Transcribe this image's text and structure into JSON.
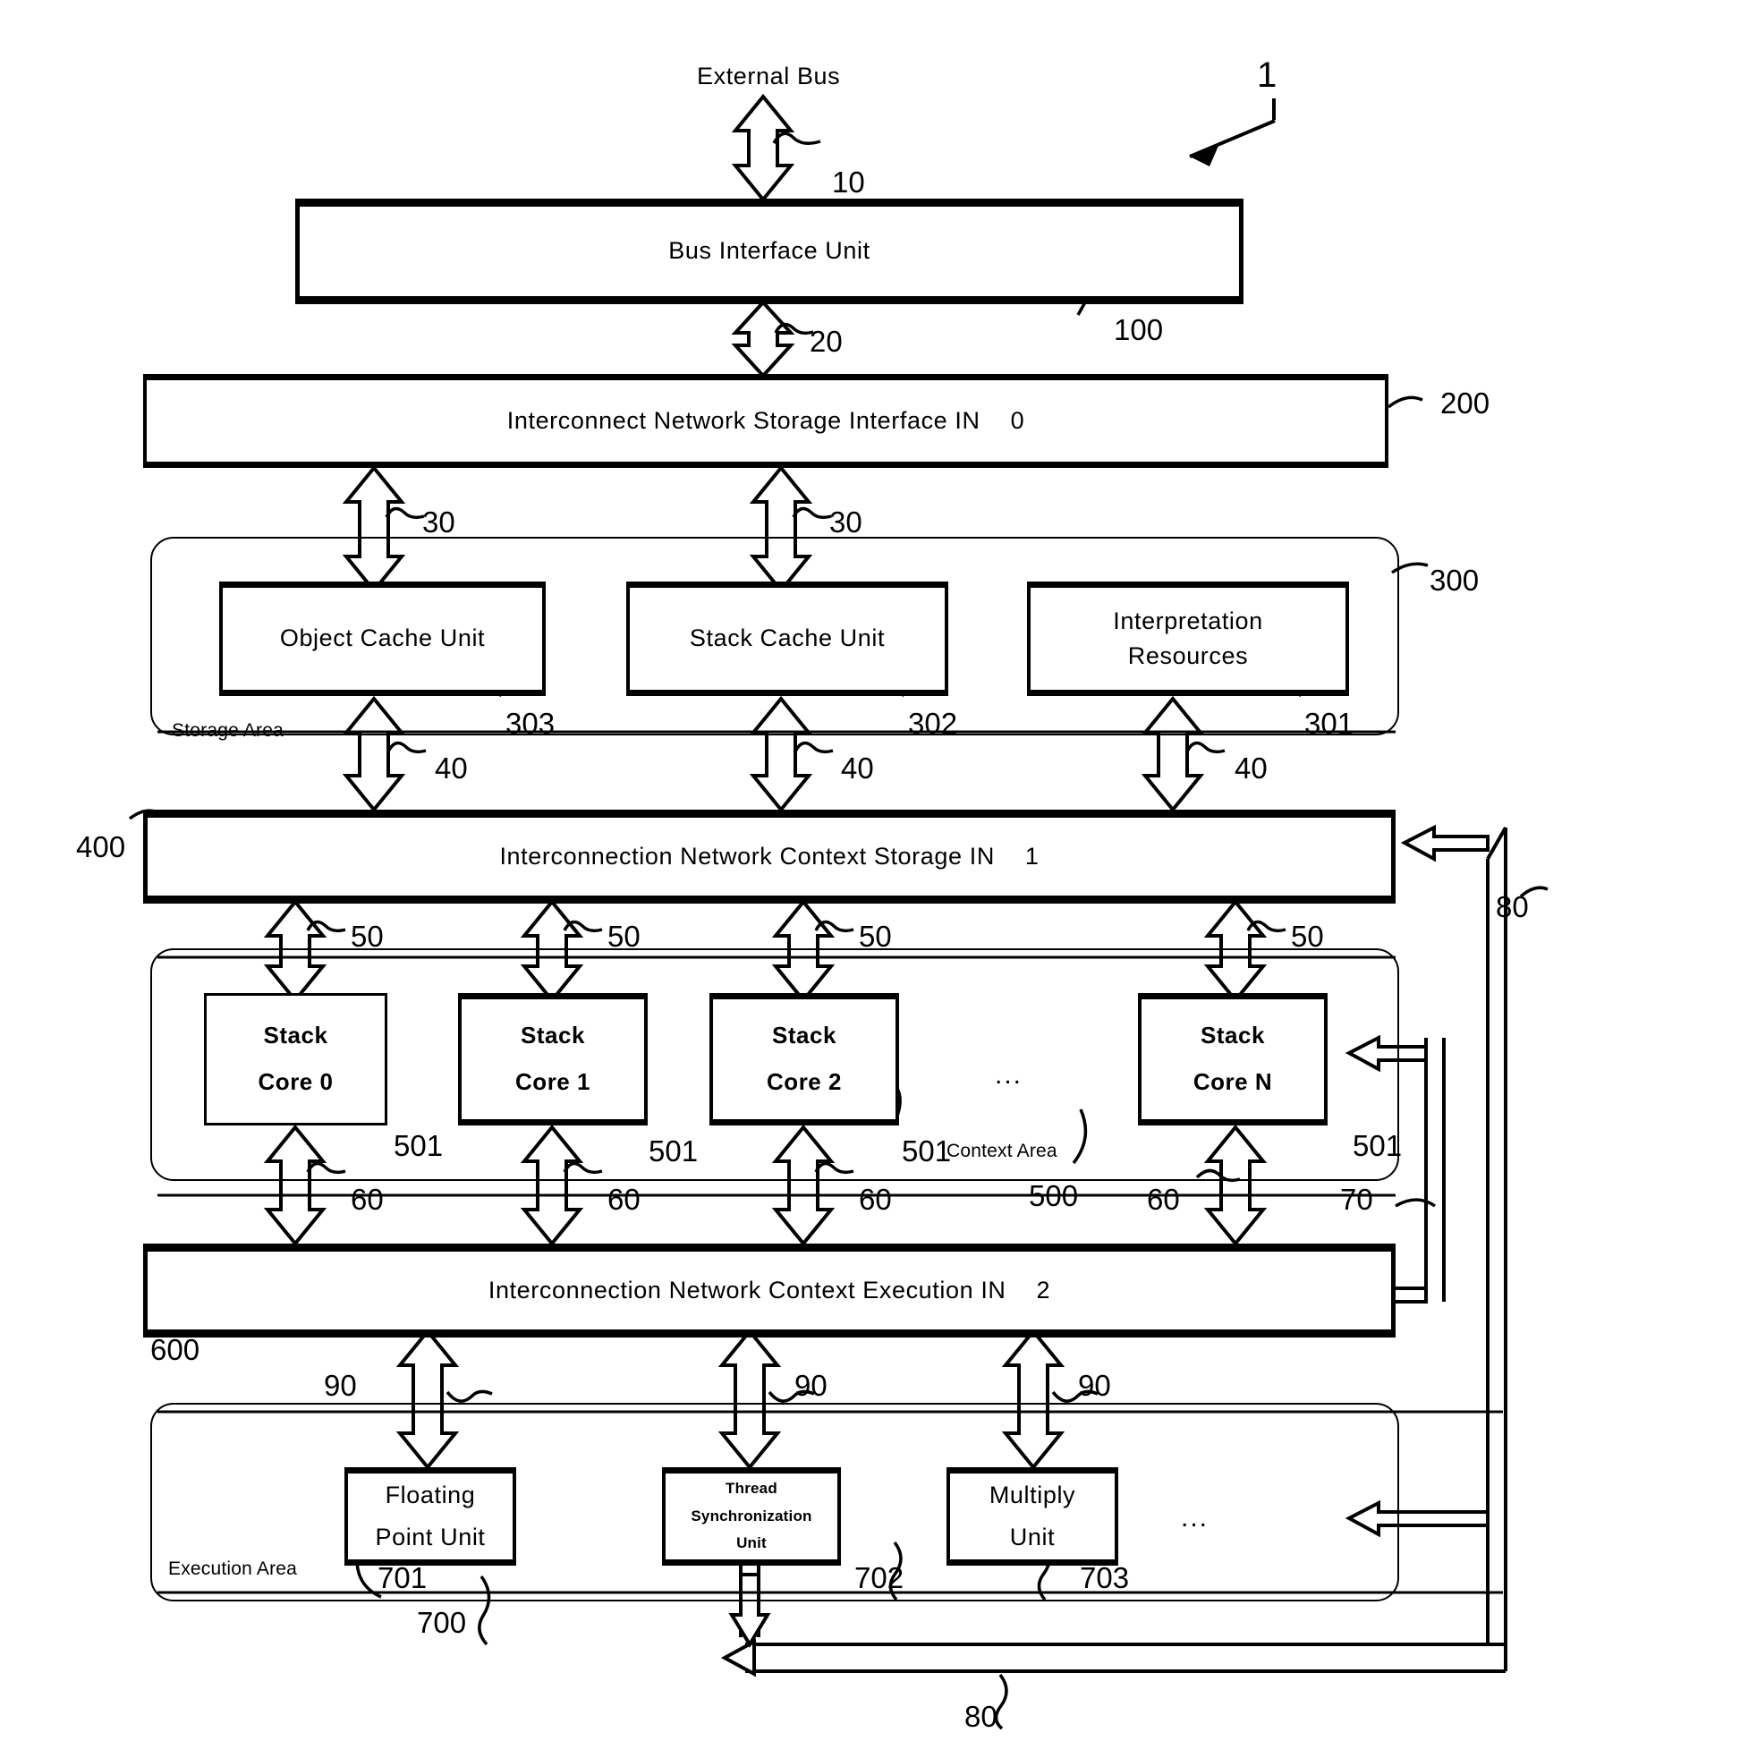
{
  "figure": {
    "ref_number": "1",
    "external_bus_label": "External Bus"
  },
  "blocks": {
    "bus_interface": {
      "label": "Bus Interface Unit",
      "ref": "100"
    },
    "storage_interface_in": {
      "label": "Interconnect Network Storage Interface IN",
      "index": "0",
      "ref": "200"
    },
    "storage_area": {
      "label": "Storage Area",
      "ref": "300"
    },
    "object_cache": {
      "label": "Object Cache Unit",
      "ref": "303"
    },
    "stack_cache": {
      "label": "Stack Cache Unit",
      "ref": "302"
    },
    "interpretation_resources": {
      "line1": "Interpretation",
      "line2": "Resources",
      "ref": "301"
    },
    "context_storage_in": {
      "label": "Interconnection Network Context Storage IN",
      "index": "1",
      "ref": "400"
    },
    "context_area": {
      "label": "Context Area",
      "ref": "500"
    },
    "context_execution_in": {
      "label": "Interconnection Network Context Execution IN",
      "index": "2",
      "ref": "600"
    },
    "execution_area": {
      "label": "Execution Area",
      "ref": "700"
    }
  },
  "stack_cores": [
    {
      "line1": "Stack",
      "line2": "Core 0",
      "ref": "501"
    },
    {
      "line1": "Stack",
      "line2": "Core 1",
      "ref": "501"
    },
    {
      "line1": "Stack",
      "line2": "Core 2",
      "ref": "501"
    },
    {
      "line1": "Stack",
      "line2": "Core N",
      "ref": "501"
    }
  ],
  "stack_core_ellipsis": "...",
  "execution_units": [
    {
      "line1": "Floating",
      "line2": "Point Unit",
      "line3": "",
      "ref": "701"
    },
    {
      "line1": "Thread",
      "line2": "Synchronization",
      "line3": "Unit",
      "ref": "702"
    },
    {
      "line1": "Multiply",
      "line2": "Unit",
      "line3": "",
      "ref": "703"
    }
  ],
  "execution_unit_ellipsis": "...",
  "connections": {
    "external_bus_to_biu": "10",
    "biu_to_storage_in": "20",
    "storage_in_to_cache_a": "30",
    "storage_in_to_cache_b": "30",
    "cache_to_context_storage_a": "40",
    "cache_to_context_storage_b": "40",
    "cache_to_context_storage_c": "40",
    "context_storage_to_core_0": "50",
    "context_storage_to_core_1": "50",
    "context_storage_to_core_2": "50",
    "context_storage_to_core_n": "50",
    "core_to_exec_in_0": "60",
    "core_to_exec_in_1": "60",
    "core_to_exec_in_2": "60",
    "core_to_exec_in_n": "60",
    "core_feedback": "70",
    "global_feedback_right": "80",
    "global_feedback_bottom": "80",
    "exec_in_to_units_0": "90",
    "exec_in_to_units_1": "90",
    "exec_in_to_units_2": "90"
  },
  "colors": {
    "ink": "#000000",
    "paper": "#ffffff"
  }
}
